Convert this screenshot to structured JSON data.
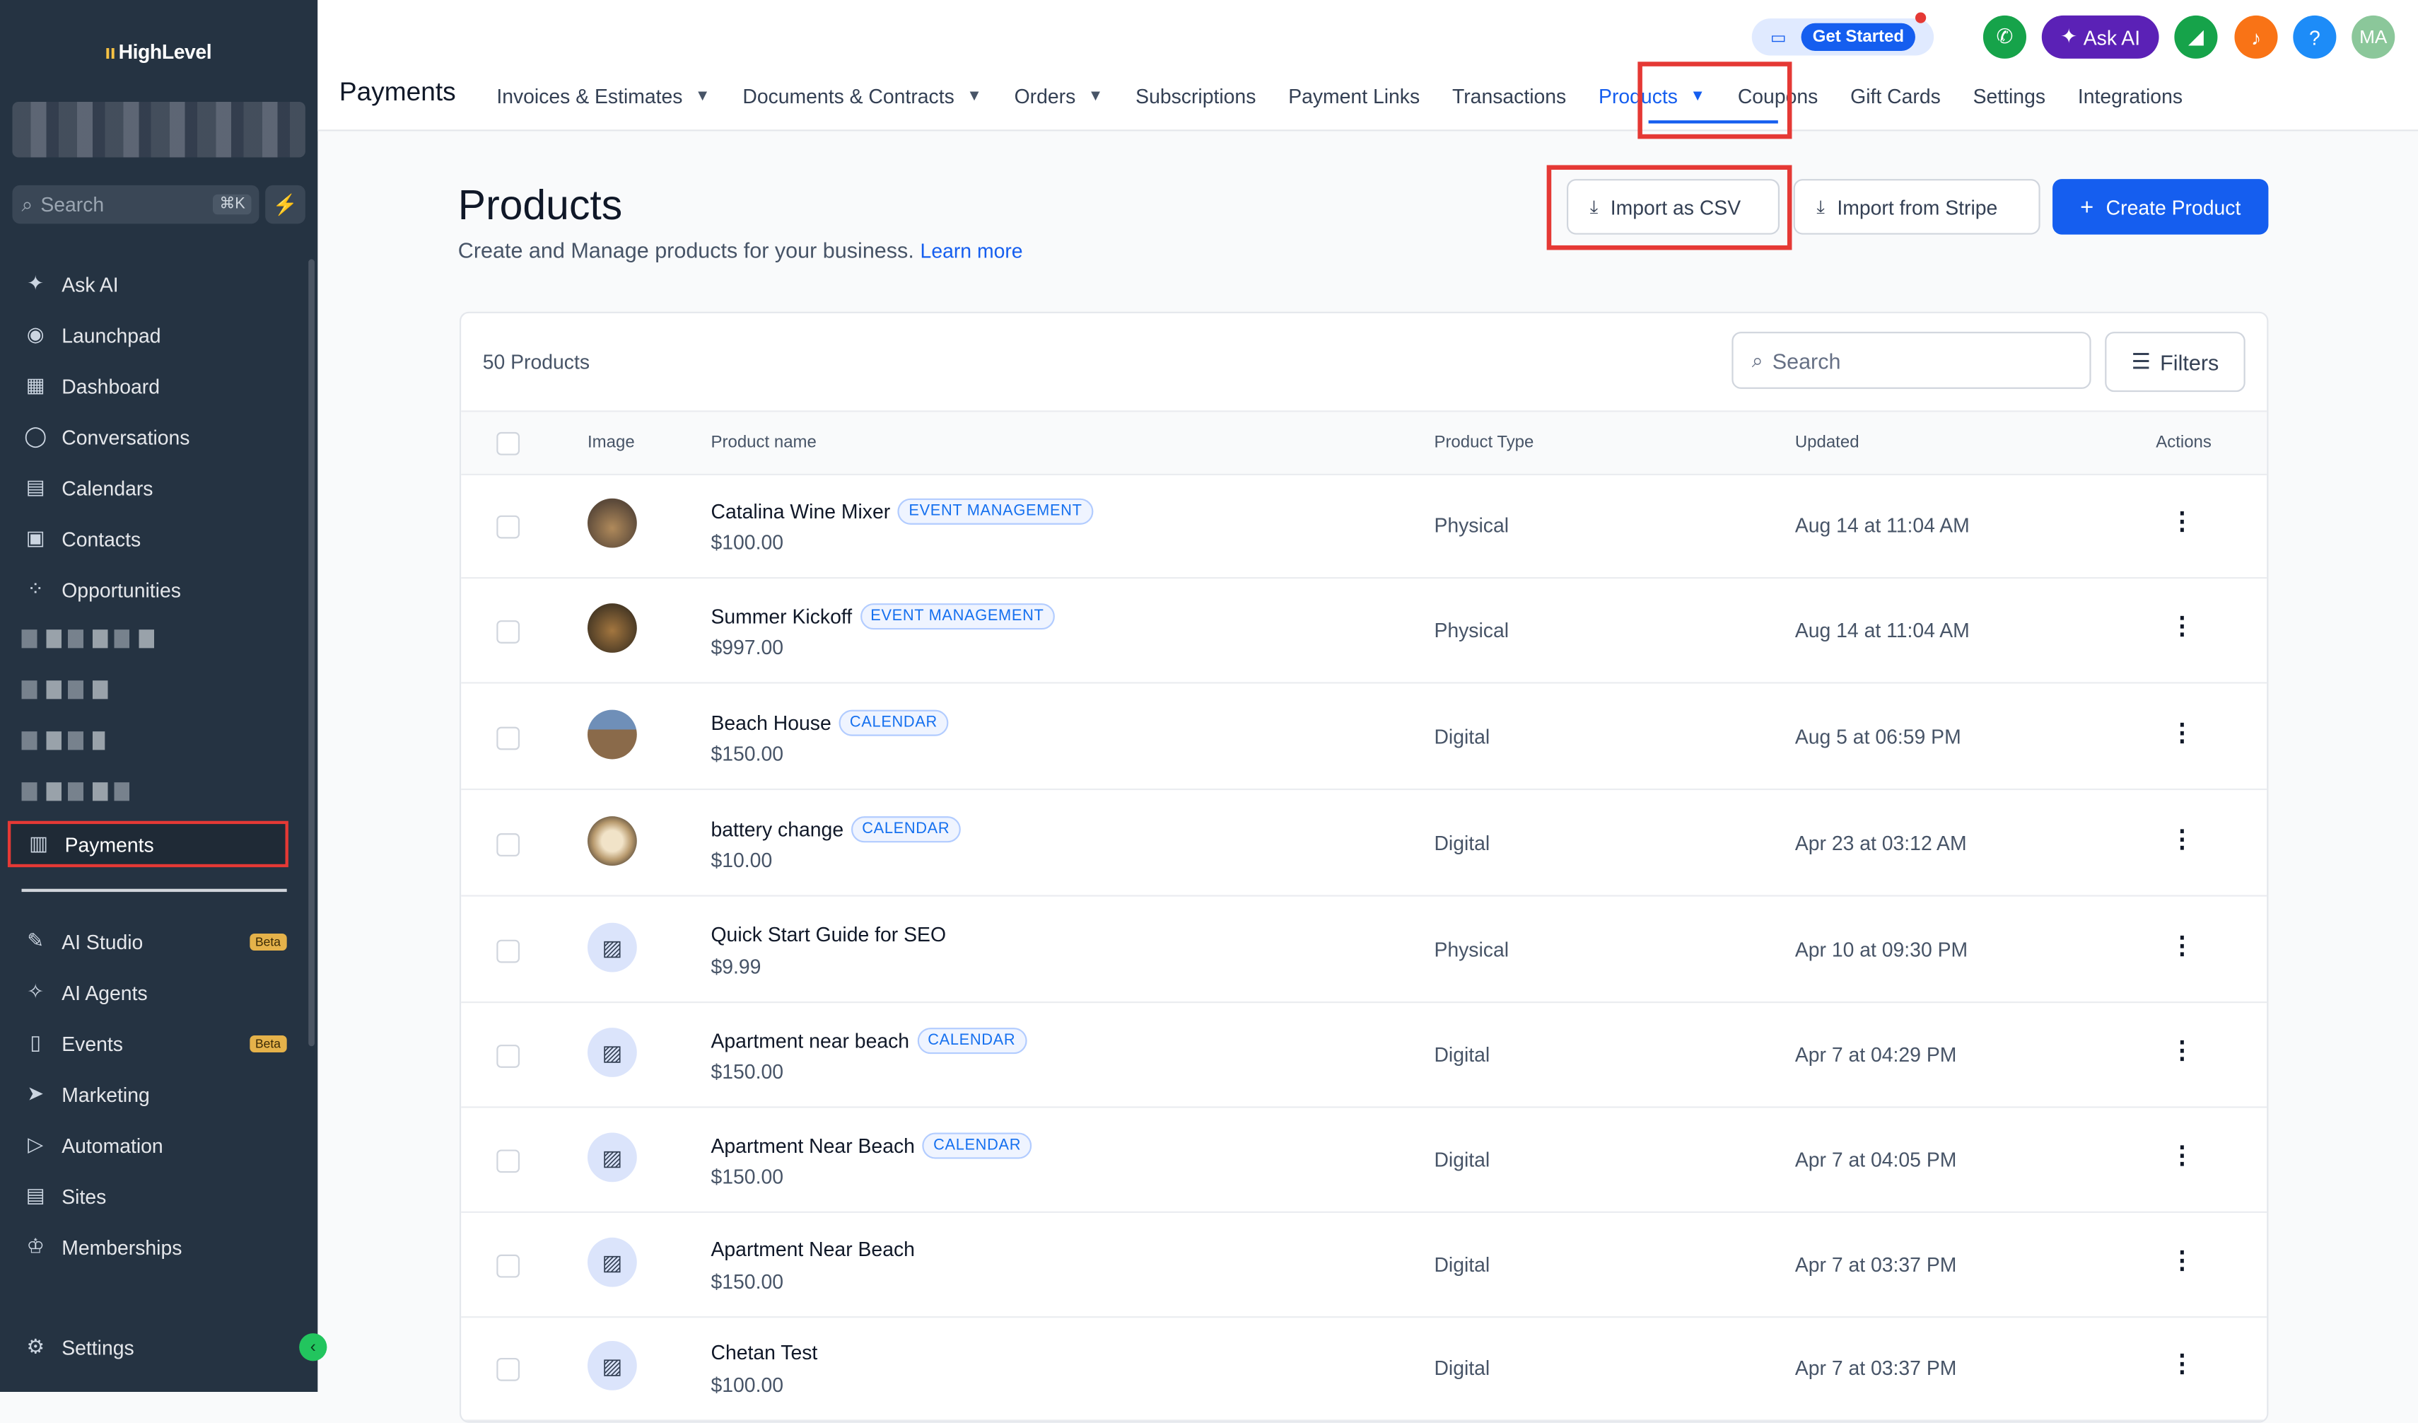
{
  "sidebar": {
    "logo": "HighLevel",
    "search_placeholder": "Search",
    "search_shortcut": "⌘K",
    "items": [
      {
        "label": "Ask AI",
        "icon": "sparkle-icon"
      },
      {
        "label": "Launchpad",
        "icon": "rocket-icon"
      },
      {
        "label": "Dashboard",
        "icon": "grid-icon"
      },
      {
        "label": "Conversations",
        "icon": "chat-icon"
      },
      {
        "label": "Calendars",
        "icon": "calendar-icon"
      },
      {
        "label": "Contacts",
        "icon": "contacts-icon"
      },
      {
        "label": "Opportunities",
        "icon": "network-icon"
      },
      {
        "label": "Payments",
        "icon": "receipt-icon"
      },
      {
        "label": "AI Studio",
        "icon": "ai-studio-icon",
        "badge": "Beta"
      },
      {
        "label": "AI Agents",
        "icon": "agents-icon"
      },
      {
        "label": "Events",
        "icon": "events-icon",
        "badge": "Beta"
      },
      {
        "label": "Marketing",
        "icon": "send-icon"
      },
      {
        "label": "Automation",
        "icon": "automation-icon"
      },
      {
        "label": "Sites",
        "icon": "sites-icon"
      },
      {
        "label": "Memberships",
        "icon": "badge-icon"
      },
      {
        "label": "Settings",
        "icon": "gear-icon"
      }
    ]
  },
  "header": {
    "title": "Payments",
    "tabs": [
      {
        "label": "Invoices & Estimates",
        "dropdown": true
      },
      {
        "label": "Documents & Contracts",
        "dropdown": true
      },
      {
        "label": "Orders",
        "dropdown": true
      },
      {
        "label": "Subscriptions"
      },
      {
        "label": "Payment Links"
      },
      {
        "label": "Transactions"
      },
      {
        "label": "Products",
        "dropdown": true,
        "active": true
      },
      {
        "label": "Coupons"
      },
      {
        "label": "Gift Cards"
      },
      {
        "label": "Settings"
      },
      {
        "label": "Integrations"
      }
    ],
    "get_started": "Get Started",
    "ask_ai": "Ask AI",
    "help": "?",
    "avatar": "MA"
  },
  "main": {
    "title": "Products",
    "subtitle": "Create and Manage products for your business.",
    "learn_more": "Learn more",
    "import_csv": "Import as CSV",
    "import_stripe": "Import from Stripe",
    "create_product": "Create Product",
    "count": "50 Products",
    "search_placeholder": "Search",
    "filters": "Filters",
    "columns": [
      "Image",
      "Product name",
      "Product Type",
      "Updated",
      "Actions"
    ]
  },
  "products": [
    {
      "name": "Catalina Wine Mixer",
      "tag": "EVENT MANAGEMENT",
      "price": "$100.00",
      "type": "Physical",
      "updated": "Aug 14 at 11:04 AM",
      "image": "photo"
    },
    {
      "name": "Summer Kickoff",
      "tag": "EVENT MANAGEMENT",
      "price": "$997.00",
      "type": "Physical",
      "updated": "Aug 14 at 11:04 AM",
      "image": "photo"
    },
    {
      "name": "Beach House",
      "tag": "CALENDAR",
      "price": "$150.00",
      "type": "Digital",
      "updated": "Aug 5 at 06:59 PM",
      "image": "photo"
    },
    {
      "name": "battery change",
      "tag": "CALENDAR",
      "price": "$10.00",
      "type": "Digital",
      "updated": "Apr 23 at 03:12 AM",
      "image": "photo"
    },
    {
      "name": "Quick Start Guide for SEO",
      "tag": "",
      "price": "$9.99",
      "type": "Physical",
      "updated": "Apr 10 at 09:30 PM",
      "image": "placeholder"
    },
    {
      "name": "Apartment near beach",
      "tag": "CALENDAR",
      "price": "$150.00",
      "type": "Digital",
      "updated": "Apr 7 at 04:29 PM",
      "image": "placeholder"
    },
    {
      "name": "Apartment Near Beach",
      "tag": "CALENDAR",
      "price": "$150.00",
      "type": "Digital",
      "updated": "Apr 7 at 04:05 PM",
      "image": "placeholder"
    },
    {
      "name": "Apartment Near Beach",
      "tag": "",
      "price": "$150.00",
      "type": "Digital",
      "updated": "Apr 7 at 03:37 PM",
      "image": "placeholder"
    },
    {
      "name": "Chetan Test",
      "tag": "",
      "price": "$100.00",
      "type": "Digital",
      "updated": "Apr 7 at 03:37 PM",
      "image": "placeholder"
    }
  ],
  "colors": {
    "accent": "#155eef",
    "highlight": "#e53935",
    "sidebar": "#253342"
  }
}
